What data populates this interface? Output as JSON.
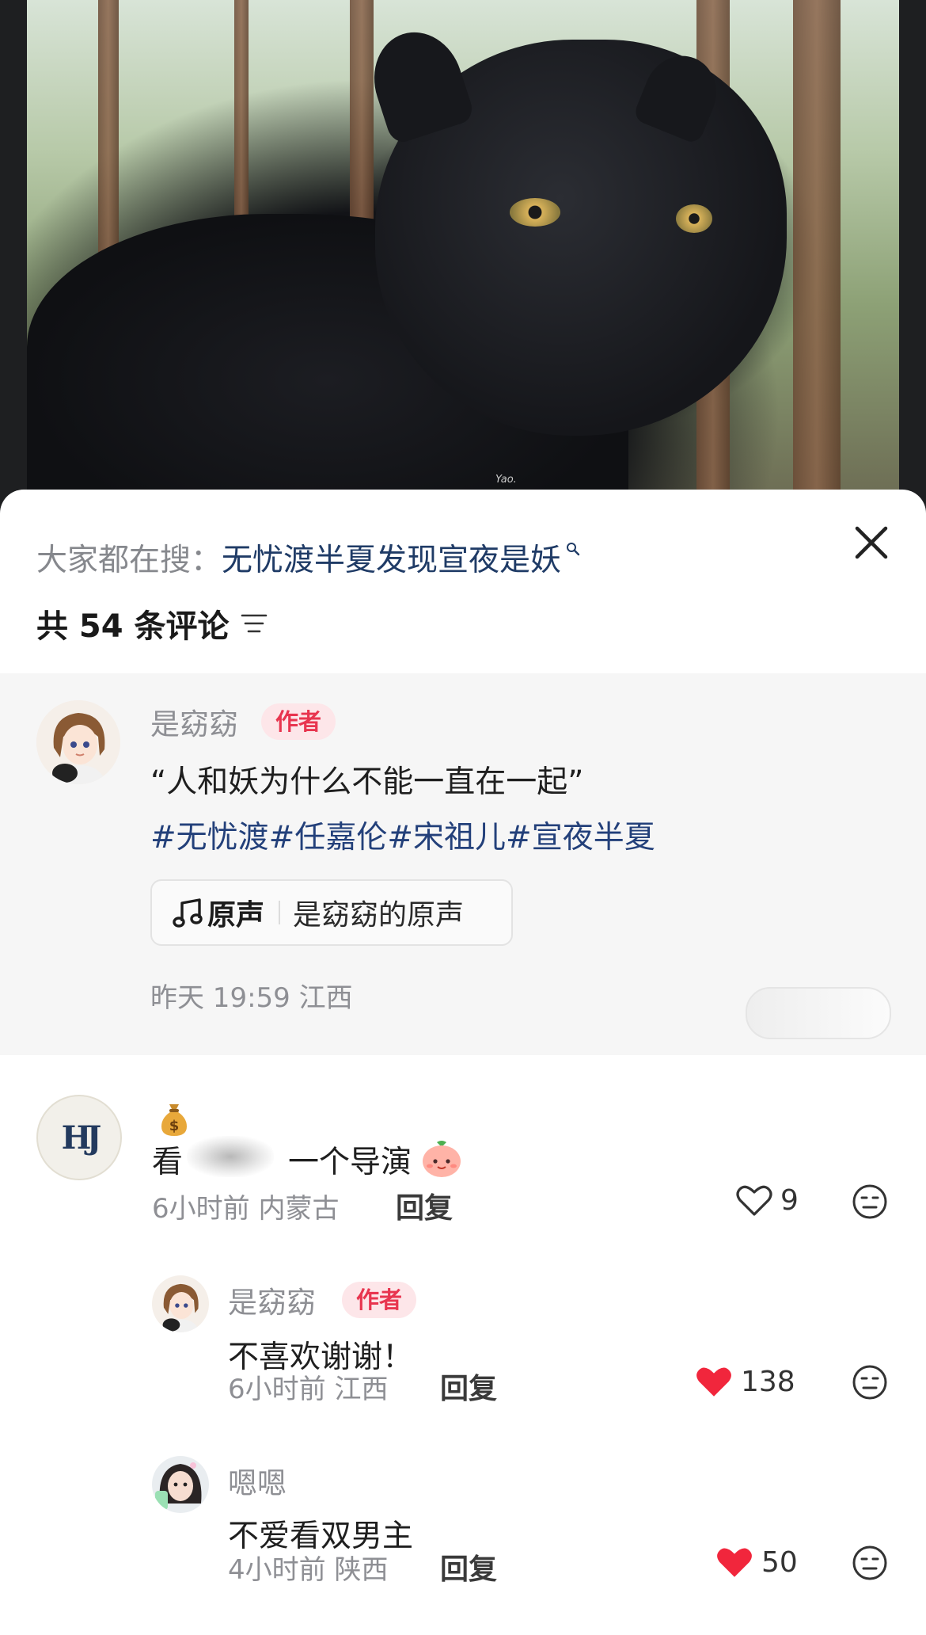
{
  "hero": {
    "watermark": "Yao."
  },
  "search": {
    "prefix": "大家都在搜：",
    "term": "无忧渡半夏发现宣夜是妖"
  },
  "comments_header": {
    "count_label": "共 54 条评论"
  },
  "author_post": {
    "author": "是窈窈",
    "badge": "作者",
    "text": "“人和妖为什么不能一直在一起”",
    "hashtags": "#无忧渡#任嘉伦#宋祖儿#宣夜半夏",
    "sound": {
      "label": "原声",
      "name": "是窈窈的原声"
    },
    "meta": "昨天 19:59  江西"
  },
  "comments": [
    {
      "avatar_text": "HJ",
      "name_icon": "moneybag-icon",
      "text_start": "看",
      "text_end": "一个导演",
      "meta": "6小时前  内蒙古",
      "reply": "回复",
      "likes": "9",
      "liked": false
    }
  ],
  "replies": [
    {
      "author": "是窈窈",
      "badge": "作者",
      "text": "不喜欢谢谢！",
      "meta": "6小时前  江西",
      "reply": "回复",
      "likes": "138",
      "liked": true
    },
    {
      "author": "嗯嗯",
      "text": "不爱看双男主",
      "meta": "4小时前  陕西",
      "reply": "回复",
      "likes": "50",
      "liked": true
    }
  ],
  "colors": {
    "badge_bg": "#fde6e9",
    "badge_text": "#e8354f",
    "like_red": "#f1263c",
    "hashtag": "#23407a"
  }
}
